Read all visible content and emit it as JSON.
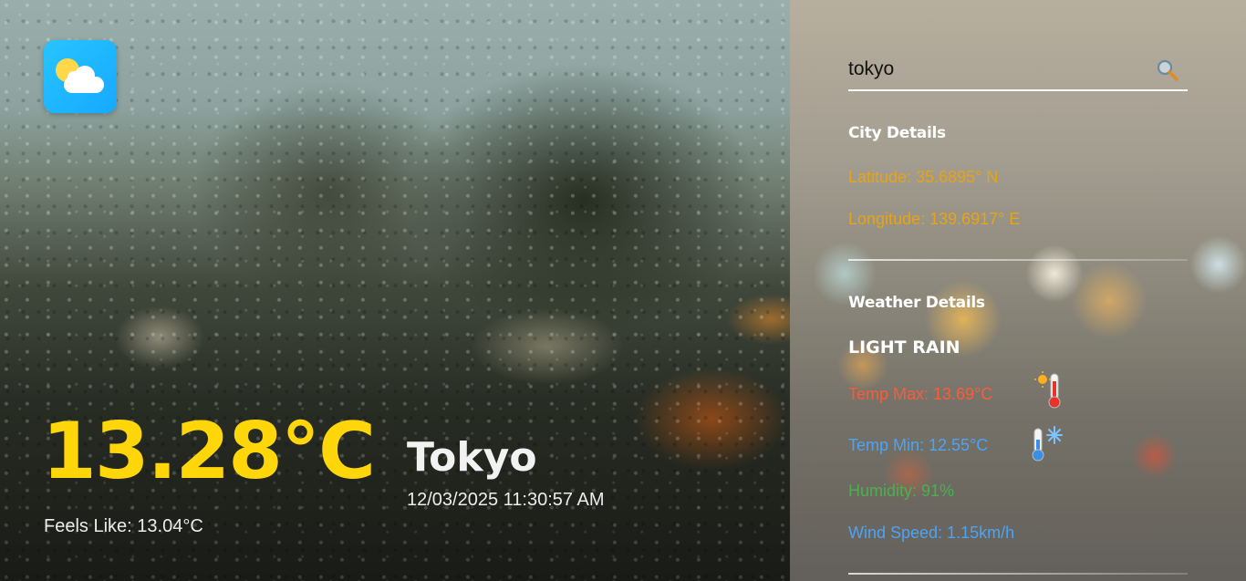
{
  "app": {
    "logo_icon": "sun-behind-cloud-icon",
    "accent_color": "#ffd60a"
  },
  "current": {
    "temperature": "13.28°C",
    "feels_like": "Feels Like: 13.04°C",
    "city": "Tokyo",
    "datetime": "12/03/2025 11:30:57 AM"
  },
  "search": {
    "value": "tokyo",
    "icon": "search-icon"
  },
  "city_details": {
    "title": "City Details",
    "latitude": "Latitude: 35.6895° N",
    "longitude": "Longitude: 139.6917° E",
    "color": "#e8a316"
  },
  "weather_details": {
    "title": "Weather Details",
    "condition": "LIGHT RAIN",
    "temp_max": "Temp Max: 13.69°C",
    "temp_max_color": "#ff5a36",
    "temp_max_icon": "hot-thermometer-icon",
    "temp_min": "Temp Min: 12.55°C",
    "temp_min_color": "#4da3f5",
    "temp_min_icon": "cold-thermometer-icon",
    "humidity": "Humidity: 91%",
    "humidity_color": "#4caf50",
    "wind_speed": "Wind Speed: 1.15km/h",
    "wind_speed_color": "#4da3f5"
  }
}
